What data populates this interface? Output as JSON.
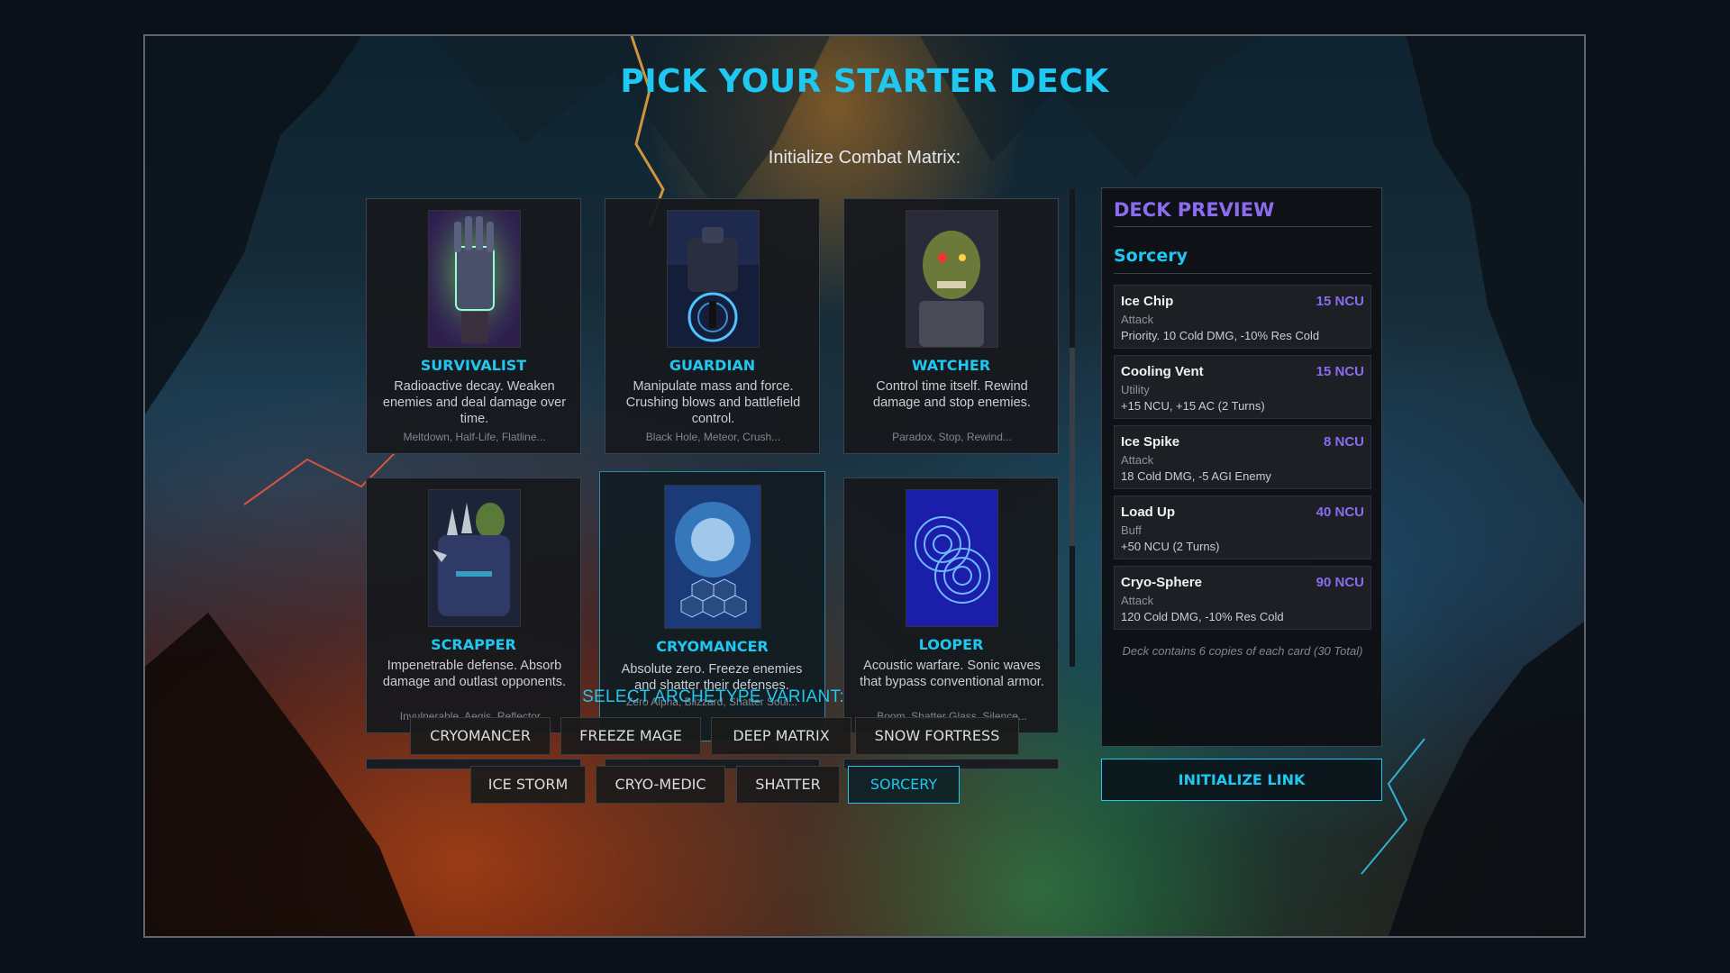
{
  "title": "PICK YOUR STARTER DECK",
  "subtitle": "Initialize Combat Matrix:",
  "cards": [
    {
      "name": "SURVIVALIST",
      "desc": "Radioactive decay. Weaken enemies and deal damage over time.",
      "tags": "Meltdown, Half-Life, Flatline..."
    },
    {
      "name": "GUARDIAN",
      "desc": "Manipulate mass and force. Crushing blows and battlefield control.",
      "tags": "Black Hole, Meteor, Crush..."
    },
    {
      "name": "WATCHER",
      "desc": "Control time itself. Rewind damage and stop enemies.",
      "tags": "Paradox, Stop, Rewind..."
    },
    {
      "name": "SCRAPPER",
      "desc": "Impenetrable defense. Absorb damage and outlast opponents.",
      "tags": "Invulnerable, Aegis, Reflector..."
    },
    {
      "name": "CRYOMANCER",
      "desc": "Absolute zero. Freeze enemies and shatter their defenses.",
      "tags": "Zero Alpha, Blizzard, Shatter Soul..."
    },
    {
      "name": "LOOPER",
      "desc": "Acoustic warfare. Sonic waves that bypass conventional armor.",
      "tags": "Boom, Shatter Glass, Silence..."
    }
  ],
  "selected_card": "CRYOMANCER",
  "variant_label": "SELECT ARCHETYPE VARIANT:",
  "variants": [
    "CRYOMANCER",
    "FREEZE MAGE",
    "DEEP MATRIX",
    "SNOW FORTRESS",
    "ICE STORM",
    "CRYO-MEDIC",
    "SHATTER",
    "SORCERY"
  ],
  "selected_variant": "SORCERY",
  "preview": {
    "heading": "DECK PREVIEW",
    "deck_name": "Sorcery",
    "entries": [
      {
        "name": "Ice Chip",
        "cost": "15 NCU",
        "type": "Attack",
        "effect": "Priority. 10 Cold DMG, -10% Res Cold"
      },
      {
        "name": "Cooling Vent",
        "cost": "15 NCU",
        "type": "Utility",
        "effect": "+15 NCU, +15 AC (2 Turns)"
      },
      {
        "name": "Ice Spike",
        "cost": "8 NCU",
        "type": "Attack",
        "effect": "18 Cold DMG, -5 AGI Enemy"
      },
      {
        "name": "Load Up",
        "cost": "40 NCU",
        "type": "Buff",
        "effect": "+50 NCU (2 Turns)"
      },
      {
        "name": "Cryo-Sphere",
        "cost": "90 NCU",
        "type": "Attack",
        "effect": "120 Cold DMG, -10% Res Cold"
      }
    ],
    "note": "Deck contains 6 copies of each card (30 Total)"
  },
  "init_button": "INITIALIZE LINK",
  "colors": {
    "accent": "#1ec8f0",
    "purple": "#8b6cf0",
    "panel": "#16181c"
  }
}
